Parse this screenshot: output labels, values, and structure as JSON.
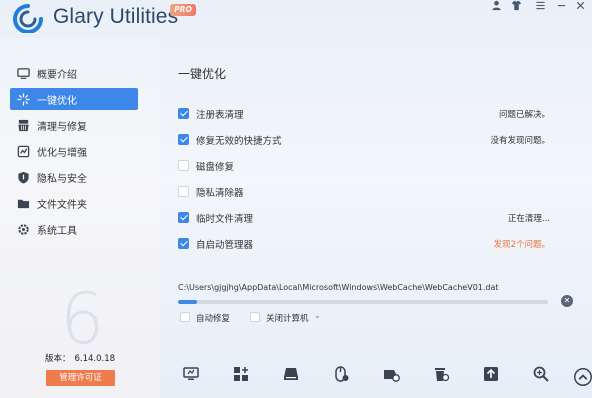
{
  "app": {
    "title": "Glary Utilities",
    "badge": "PRO"
  },
  "title_controls": [
    "user-icon",
    "shirt-icon",
    "menu-icon",
    "minimize-icon",
    "close-icon"
  ],
  "sidebar": {
    "items": [
      {
        "label": "概要介绍",
        "icon": "monitor-icon",
        "active": false
      },
      {
        "label": "一键优化",
        "icon": "sparkle-icon",
        "active": true
      },
      {
        "label": "清理与修复",
        "icon": "broom-icon",
        "active": false
      },
      {
        "label": "优化与增强",
        "icon": "optimize-icon",
        "active": false
      },
      {
        "label": "隐私与安全",
        "icon": "shield-icon",
        "active": false
      },
      {
        "label": "文件文件夹",
        "icon": "folder-icon",
        "active": false
      },
      {
        "label": "系统工具",
        "icon": "toolbox-icon",
        "active": false
      }
    ],
    "version_label": "版本：",
    "version_value": "6.14.0.18",
    "license_button": "管理许可证",
    "watermark": "6"
  },
  "main": {
    "title": "一键优化",
    "tasks": [
      {
        "label": "注册表清理",
        "checked": true,
        "status": "问题已解决。"
      },
      {
        "label": "修复无效的快捷方式",
        "checked": true,
        "status": "没有发现问题。"
      },
      {
        "label": "磁盘修复",
        "checked": false,
        "status": ""
      },
      {
        "label": "隐私清除器",
        "checked": false,
        "status": ""
      },
      {
        "label": "临时文件清理",
        "checked": true,
        "status": "正在清理..."
      },
      {
        "label": "自启动管理器",
        "checked": true,
        "status": "发现2个问题。"
      }
    ],
    "current_path": "C:\\Users\\gjgjhg\\AppData\\Local\\Microsoft\\Windows\\WebCache\\WebCacheV01.dat",
    "progress": 0.05,
    "options": {
      "auto_repair": {
        "label": "自动修复",
        "checked": false
      },
      "shutdown": {
        "label": "关闭计算机",
        "checked": false
      }
    }
  },
  "bottom_tools": [
    "screen-icon",
    "apps-icon",
    "disk-icon",
    "mouse-icon",
    "drive-icon",
    "trash-icon",
    "upload-icon",
    "search-icon",
    "up-arrow-icon"
  ],
  "colors": {
    "accent": "#3d87e8",
    "orange": "#e8743b",
    "license": "#f07c4e"
  }
}
